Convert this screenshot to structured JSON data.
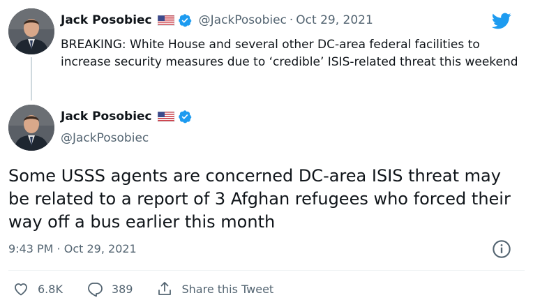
{
  "quoted_tweet": {
    "display_name": "Jack Posobiec",
    "handle": "@JackPosobiec",
    "separator": "·",
    "date": "Oct 29, 2021",
    "text": "BREAKING: White House and several other DC-area federal facilities to increase security measures due to ‘credible’ ISIS-related threat this weekend"
  },
  "main_tweet": {
    "display_name": "Jack Posobiec",
    "handle": "@JackPosobiec",
    "text": "Some USSS agents are concerned DC-area ISIS threat may be related to a report of 3 Afghan refugees who forced their way off a bus earlier this month",
    "timestamp": "9:43 PM · Oct 29, 2021"
  },
  "actions": {
    "likes": "6.8K",
    "replies": "389",
    "share_label": "Share this Tweet"
  },
  "icons": {
    "logo": "twitter-bird-icon",
    "verified": "verified-badge-icon",
    "flag": "us-flag-icon",
    "info": "info-icon",
    "like": "heart-icon",
    "reply": "reply-bubble-icon",
    "share": "share-icon"
  },
  "colors": {
    "brand": "#1d9bf0",
    "text": "#0f1419",
    "secondary_text": "#536471",
    "thread_line": "#cfd9de"
  }
}
